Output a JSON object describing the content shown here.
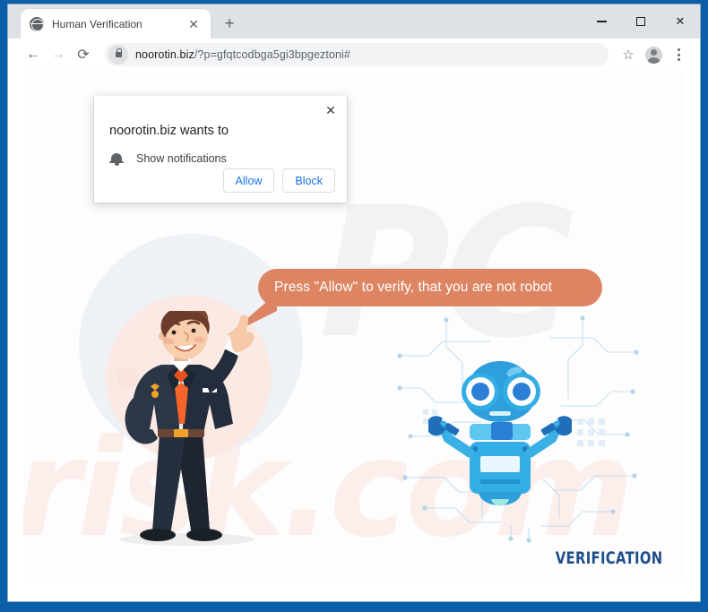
{
  "browser": {
    "tab": {
      "title": "Human Verification",
      "favicon": "globe-icon",
      "close_label": "✕"
    },
    "new_tab_label": "+",
    "window_controls": {
      "minimize": "─",
      "maximize": "□",
      "close": "✕"
    },
    "nav": {
      "back": "←",
      "forward": "→",
      "reload": "⟳"
    },
    "omnibox": {
      "lock": "lock-icon",
      "domain": "noorotin.biz",
      "path": "/?p=gfqtcodbga5gi3bpgeztoni#"
    },
    "toolbar_icons": {
      "bookmark": "☆",
      "profile": "profile-avatar-icon",
      "menu": "three-dot-menu-icon"
    }
  },
  "permission_dialog": {
    "title": "noorotin.biz wants to",
    "close_label": "✕",
    "permission_icon": "bell-icon",
    "permission_label": "Show notifications",
    "allow_label": "Allow",
    "block_label": "Block"
  },
  "page": {
    "speech_bubble": "Press \"Allow\" to verify, that you are not robot",
    "footer_label": "VERIFICATION",
    "watermark_top": "PC",
    "watermark_bottom": "risk.com",
    "illustrations": {
      "man": "pointing-businessman-illustration",
      "robot": "blue-robot-illustration",
      "circuit": "circuit-board-pattern"
    }
  },
  "colors": {
    "bubble": "#dd8562",
    "accent_blue": "#1a73e8",
    "window_border": "#0b5ea8",
    "footer_text": "#1f4e8c",
    "robot_blue": "#29a9e8"
  }
}
